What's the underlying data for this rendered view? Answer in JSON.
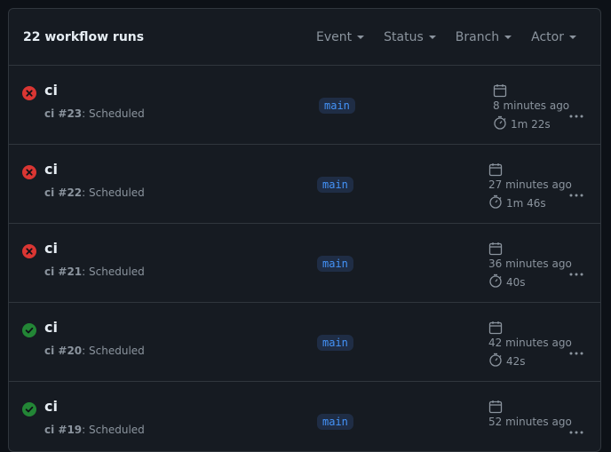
{
  "header": {
    "count_label": "22 workflow runs",
    "filters": [
      {
        "label": "Event"
      },
      {
        "label": "Status"
      },
      {
        "label": "Branch"
      },
      {
        "label": "Actor"
      }
    ]
  },
  "colors": {
    "failure": "#da3633",
    "success": "#238636",
    "branch_text": "#4493f8",
    "branch_bg": "#1f2d45",
    "muted": "#8b949e"
  },
  "runs": [
    {
      "status": "failure",
      "name": "ci",
      "run_id": "ci #23",
      "trigger": ": Scheduled",
      "branch": "main",
      "ago": "8 minutes ago",
      "duration": "1m 22s"
    },
    {
      "status": "failure",
      "name": "ci",
      "run_id": "ci #22",
      "trigger": ": Scheduled",
      "branch": "main",
      "ago": "27 minutes ago",
      "duration": "1m 46s"
    },
    {
      "status": "failure",
      "name": "ci",
      "run_id": "ci #21",
      "trigger": ": Scheduled",
      "branch": "main",
      "ago": "36 minutes ago",
      "duration": "40s"
    },
    {
      "status": "success",
      "name": "ci",
      "run_id": "ci #20",
      "trigger": ": Scheduled",
      "branch": "main",
      "ago": "42 minutes ago",
      "duration": "42s"
    },
    {
      "status": "success",
      "name": "ci",
      "run_id": "ci #19",
      "trigger": ": Scheduled",
      "branch": "main",
      "ago": "52 minutes ago",
      "duration": ""
    }
  ]
}
